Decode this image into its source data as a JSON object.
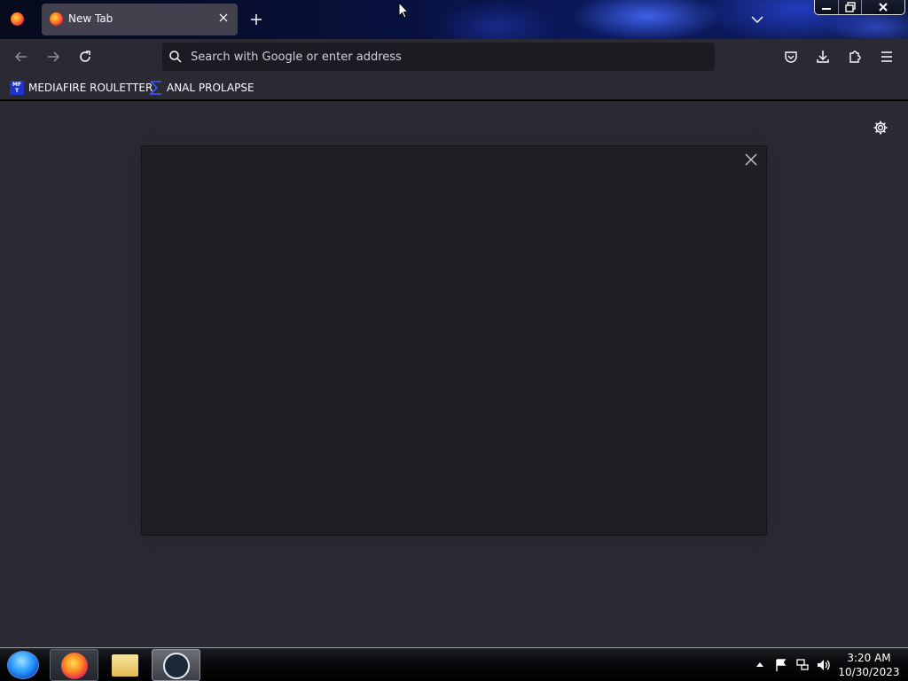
{
  "browser": {
    "tab": {
      "title": "New Tab"
    },
    "urlbar": {
      "placeholder": "Search with Google or enter address"
    },
    "bookmarks": [
      {
        "label": "MEDIAFIRE ROULETTER",
        "icon": "mediafire-icon",
        "icon_text": "MF T"
      },
      {
        "label": "ANAL PROLAPSE",
        "icon": "sigma-icon"
      }
    ]
  },
  "taskbar": {
    "apps": [
      "firefox",
      "file-explorer",
      "steam"
    ],
    "clock": {
      "time": "3:20 AM",
      "date": "10/30/2023"
    }
  },
  "colors": {
    "toolbar": "#2b2a33",
    "urlbar": "#1c1b22",
    "active_tab": "#42414d",
    "overlay": "#1f2024",
    "accent": "#1d33c9"
  }
}
